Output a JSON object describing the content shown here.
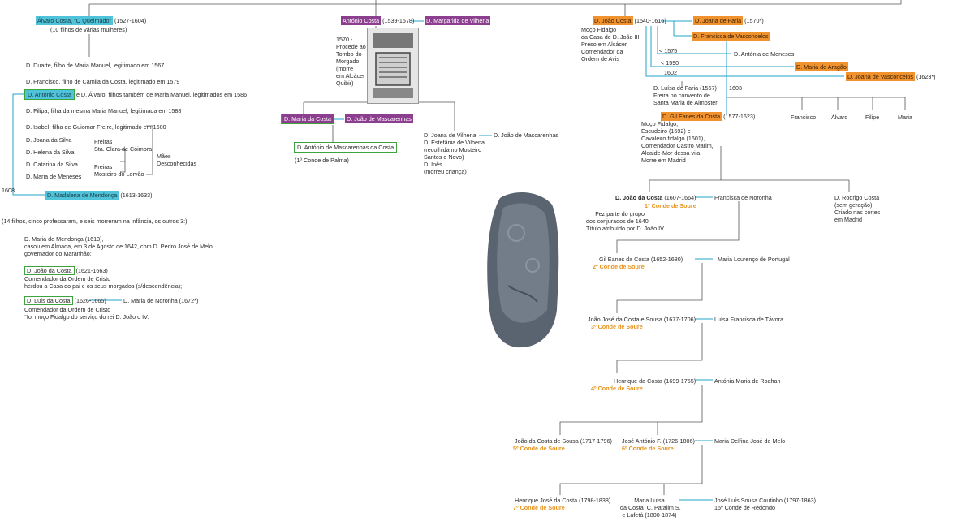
{
  "col1": {
    "alvaro": {
      "name": "Álvaro Costa, \"O Queimado\"",
      "dates": "(1527-1604)",
      "note": "(10 filhos de várias mulheres)"
    },
    "duarte": "D. Duarte, filho de Maria Manuel, legitimado em 1567",
    "francisco": "D. Francisco, filho de Camila da Costa, legitimado em 1579",
    "antonio": {
      "name": "D. António Costa",
      "rest": "e D. Álvaro, filhos também de Maria Manuel, legitimados em 1586"
    },
    "filipa": "D. Filipa, filha da mesma Maria Manuel, legitimada em 1588",
    "isabel": "D. Isabel, filha de Guiomar Freire, legitimado em 1600",
    "joana": "D. Joana da Silva",
    "helena": "D. Helena da Silva",
    "freiras1": "Freiras\nSta. Clara de Coimbra",
    "catarina": "D. Catarina da Silva",
    "mariamen": "D. Maria de Meneses",
    "freiras2": "Freiras\nMosteiro do Lorvão",
    "maes": "Mães\nDesconhecidas",
    "year1608": "1608",
    "madalena": {
      "name": "D. Madalena de Mendonça",
      "dates": "(1613-1633)"
    },
    "filhos": "(14 filhos, cinco professaram, e seis morreram na infância, os outros 3:)",
    "maria": "D. Maria de Mendonça (1613),\ncasou em Almada, em 3 de Agosto de 1642, com D. Pedro José de Melo,\ngovernador do Maranhão;",
    "joao": {
      "name": "D. João da Costa",
      "dates": "(1621-1663)",
      "note": "Comendador da Ordem de Cristo\nherdou a Casa do pai e os seus morgados (s/descendência);"
    },
    "luis": {
      "name": "D. Luís da Costa",
      "dates": "(1626-1665)",
      "note": "Comendador da Ordem de Cristo\n°foi moço Fidalgo do serviço do rei D. João o IV."
    },
    "luis_spouse": "D. Maria de Noronha (1672*)"
  },
  "col2": {
    "antonio": {
      "name": "António Costa",
      "dates": "(1539-1578)"
    },
    "margarida": "D. Margarida de Vilhena",
    "doc_note": "1570 -\nProcede ao\nTombo do\nMorgado\n(morre\nem Alcácer\nQuibir)",
    "maria": "D. Maria da Costa",
    "joaomasc": "D. João de Mascarenhas",
    "antoniomasc": "D. António de Mascarenhas da Costa",
    "conde_palma": "(1º Conde de Palma)",
    "joana_list": "D. Joana de Vilhena\nD. Estefânia de Vilhena\n(recolhida no Mosteiro\nSantos o Novo)\nD. Inês\n(morreu criança)",
    "joana_spouse": "D. João de Mascarenhas"
  },
  "col3": {
    "joao": {
      "name": "D. João Costa",
      "dates": "(1540-1616)"
    },
    "joao_note": "Moço Fidalgo\nda Casa de D. João III\nPreso em Alcácer\nComendador da\nOrdem de Avis",
    "joana_faria": {
      "name": "D. Joana de Faria",
      "dates": "(1570*)"
    },
    "francisca": "D. Francisca de Vasconcelos",
    "lt1575": "< 1575",
    "antonia": "D. Antónia de Meneses",
    "lt1590": "< 1590",
    "maria_aragao": "D. Maria de Aragão",
    "y1602": "1602",
    "joana_vasc": {
      "name": "D. Joana de Vasconcelos",
      "dates": "(1623*)"
    },
    "luisa": "D. Luísa de Faria (1567)\nFreira no convento de\nSanta Maria de Almoster",
    "y1603": "1603",
    "kids": [
      "Francisco",
      "Álvaro",
      "Filipe",
      "Maria"
    ],
    "gil": {
      "name": "D. Gil Eanes da Costa",
      "dates": "(1577-1623)"
    },
    "gil_note": "Moço Fidalgo,\nEscudeiro (1592) e\nCavaleiro fidalgo (1601),\nComendador Castro Marim,\nAlcaide-Mor dessa vila\nMorre em Madrid",
    "joao1": {
      "name": "D. João da Costa",
      "dates": "(1607-1664)",
      "title": "1º Conde de Soure",
      "note": "Fez parte do grupo\ndos conjurados de 1640\nTítulo atribuído por D. João IV"
    },
    "joao1_spouse": "Francisca de Noronha",
    "rodrigo": "D. Rodrigo Costa\n(sem geração)\nCriado nas cortes\nem Madrid",
    "gil2": {
      "name": "Gil Eanes da Costa (1652-1680)",
      "title": "2º Conde de Soure",
      "spouse": "Maria Lourenço de Portugal"
    },
    "joao3": {
      "name": "João José da Costa e Sousa (1677-1706)",
      "title": "3º Conde de Soure",
      "spouse": "Luísa Francisca de Távora"
    },
    "henrique4": {
      "name": "Henrique da Costa (1699-1755)",
      "title": "4º Conde de Soure",
      "spouse": "Antónia Maria de Roahan"
    },
    "joao5": {
      "name": "João da Costa de Sousa (1717-1796)",
      "title": "5º Conde de Soure"
    },
    "jose6": {
      "name": "José António F. (1726-1806)",
      "title": "6º Conde de Soure",
      "spouse": "Maria Delfina José de Melo"
    },
    "henrique7": {
      "name": "Henrique José da Costa (1798-1838)",
      "title": "7º Conde de Soure"
    },
    "maria_luisa": "Maria Luísa\nda Costa  C. Patalim S.\ne Lafetá (1800-1874)",
    "jose_luis": "José Luís Sousa Coutinho (1797-1863)\n15º Conde de Redondo"
  },
  "colors": {
    "blue": "#4fc3d9",
    "purple": "#8d3f8f",
    "orange": "#f0922e",
    "green": "#3da33d",
    "gold": "#e8931c"
  }
}
